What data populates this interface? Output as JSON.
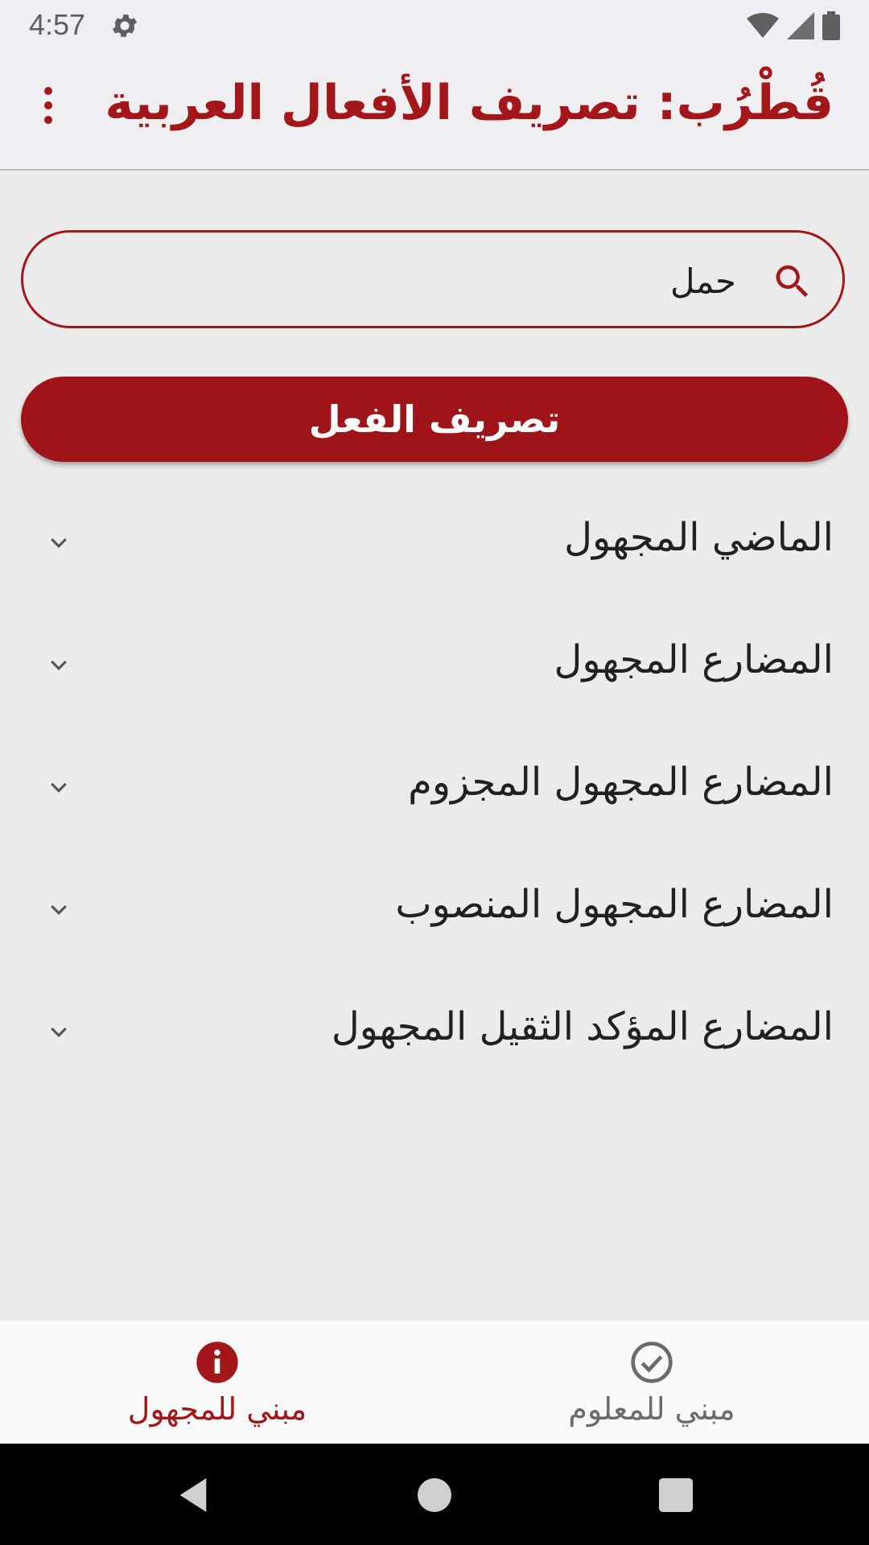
{
  "status_bar": {
    "time": "4:57",
    "icons": [
      "gear-icon",
      "wifi-icon",
      "signal-icon",
      "battery-icon"
    ]
  },
  "app_bar": {
    "title": "قُطْرُب: تصريف الأفعال العربية",
    "menu_icon": "more-vertical-icon"
  },
  "search": {
    "value": "حمل",
    "icon": "search-icon"
  },
  "conjugate_button": {
    "label": "تصريف الفعل"
  },
  "tenses": [
    {
      "label": "الماضي المجهول"
    },
    {
      "label": "المضارع المجهول"
    },
    {
      "label": "المضارع المجهول المجزوم"
    },
    {
      "label": "المضارع المجهول المنصوب"
    },
    {
      "label": "المضارع المؤكد الثقيل المجهول"
    }
  ],
  "bottom_nav": {
    "tabs": [
      {
        "label": "مبني للمجهول",
        "icon": "info-icon",
        "active": true
      },
      {
        "label": "مبني للمعلوم",
        "icon": "check-circle-icon",
        "active": false
      }
    ]
  },
  "colors": {
    "accent": "#a3171b",
    "button": "#9f1418",
    "background": "#ebebec"
  }
}
